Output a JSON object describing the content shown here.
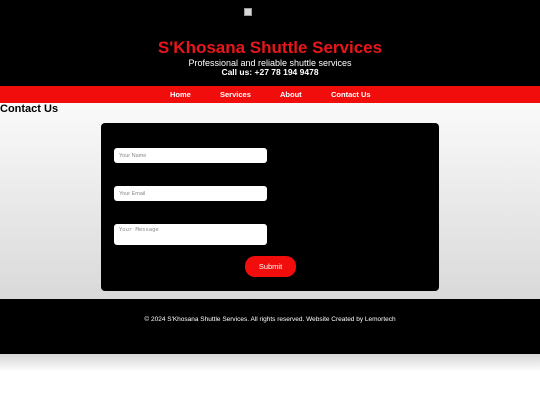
{
  "header": {
    "logo_icon": "broken-image-icon",
    "title": "S'Khosana Shuttle Services",
    "tagline": "Professional and reliable shuttle services",
    "phone": "Call us: +27 78 194 9478"
  },
  "nav": {
    "items": [
      {
        "label": "Home"
      },
      {
        "label": "Services"
      },
      {
        "label": "About"
      },
      {
        "label": "Contact Us"
      }
    ]
  },
  "contact": {
    "heading": "Contact Us",
    "name_placeholder": "Your Name",
    "email_placeholder": "Your Email",
    "message_placeholder": "Your Message",
    "submit_label": "Submit"
  },
  "footer": {
    "copyright": "© 2024 S'Khosana Shuttle Services. All rights reserved. Website Created by Lemortech"
  },
  "colors": {
    "brand_red": "#f20d0d",
    "title_red": "#e8161b",
    "background_dark": "#000000"
  }
}
